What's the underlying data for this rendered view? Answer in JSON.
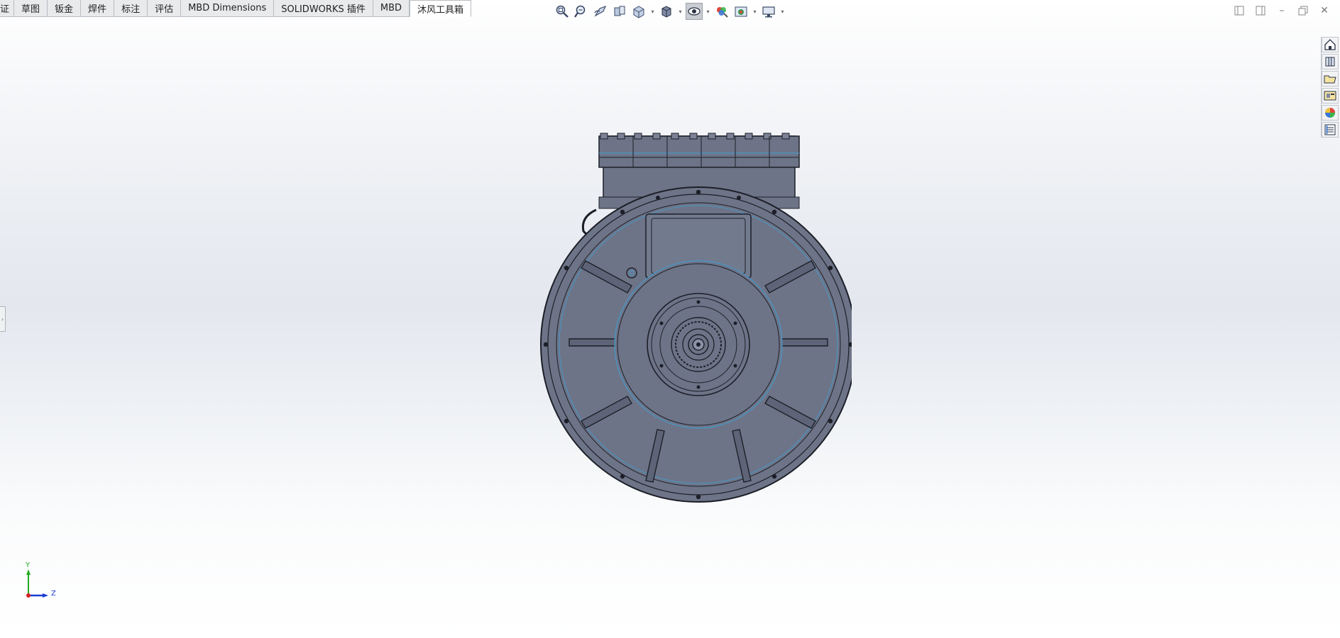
{
  "command_manager": {
    "tabs": [
      {
        "label": "证"
      },
      {
        "label": "草图"
      },
      {
        "label": "钣金"
      },
      {
        "label": "焊件"
      },
      {
        "label": "标注"
      },
      {
        "label": "评估"
      },
      {
        "label": "MBD Dimensions"
      },
      {
        "label": "SOLIDWORKS 插件"
      },
      {
        "label": "MBD"
      },
      {
        "label": "沐风工具箱"
      }
    ],
    "active_tab": "沐风工具箱"
  },
  "heads_up_toolbar": {
    "icons": [
      "zoom-to-fit-icon",
      "zoom-to-area-icon",
      "previous-view-icon",
      "section-view-icon",
      "view-orientation-icon",
      "display-style-icon",
      "hide-show-items-icon",
      "edit-appearance-icon",
      "apply-scene-icon",
      "view-settings-icon"
    ]
  },
  "window_controls": {
    "icons": [
      "tile-left-icon",
      "tile-right-icon",
      "minimize-icon",
      "restore-icon",
      "close-icon"
    ],
    "close_glyph": "✕",
    "minimize_glyph": "–"
  },
  "task_pane": {
    "icons": [
      "solidworks-resources-icon",
      "design-library-icon",
      "file-explorer-icon",
      "view-palette-icon",
      "appearances-scenes-icon",
      "custom-properties-icon"
    ]
  },
  "triad": {
    "y_label": "Y",
    "z_label": "Z",
    "colors": {
      "y": "#22aa22",
      "z": "#1a3dd6",
      "x": "#d62222"
    }
  },
  "model": {
    "name_icon": "motor-housing-model",
    "fill": "#6e7487",
    "edge": "#1c1f28",
    "silhouette_highlight": "#3aa0d8"
  }
}
